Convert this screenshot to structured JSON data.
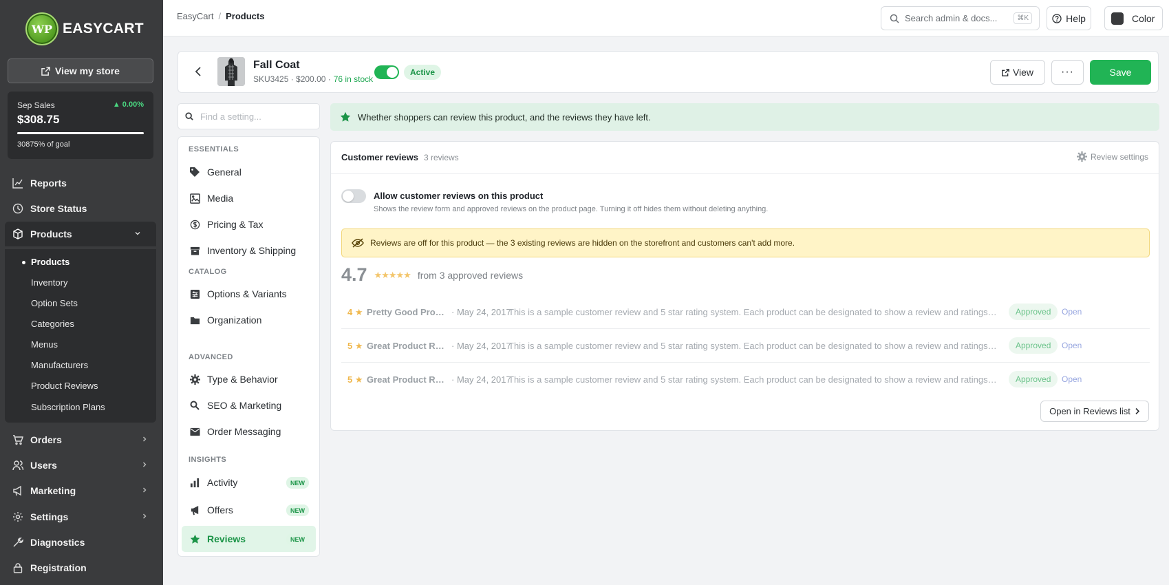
{
  "app": {
    "logo_text": "EASYCART",
    "logo_initials": "WP"
  },
  "sidebar": {
    "view_store_label": "View my store",
    "sales": {
      "label": "Sep Sales",
      "change": "▲ 0.00%",
      "amount": "$308.75",
      "goal_text": "30875% of goal",
      "progress": 1.0
    },
    "nav": [
      {
        "label": "Reports",
        "icon": "chart-line-icon"
      },
      {
        "label": "Store Status",
        "icon": "clock-icon"
      },
      {
        "label": "Products",
        "icon": "box-icon",
        "expanded": true
      },
      {
        "label": "Orders",
        "icon": "cart-icon"
      },
      {
        "label": "Users",
        "icon": "users-icon"
      },
      {
        "label": "Marketing",
        "icon": "megaphone-icon"
      },
      {
        "label": "Settings",
        "icon": "gear-icon"
      },
      {
        "label": "Diagnostics",
        "icon": "wrench-icon"
      },
      {
        "label": "Registration",
        "icon": "lock-icon"
      }
    ],
    "products_sub": [
      {
        "label": "Products",
        "current": true
      },
      {
        "label": "Inventory"
      },
      {
        "label": "Option Sets"
      },
      {
        "label": "Categories"
      },
      {
        "label": "Menus"
      },
      {
        "label": "Manufacturers"
      },
      {
        "label": "Product Reviews"
      },
      {
        "label": "Subscription Plans"
      }
    ]
  },
  "topbar": {
    "breadcrumb": [
      "EasyCart",
      "Products"
    ],
    "search_placeholder": "Search admin & docs...",
    "search_shortcut": "⌘K",
    "help_label": "Help",
    "color_label": "Color"
  },
  "product": {
    "name": "Fall Coat",
    "meta": "SKU3425 · $200.00 ·",
    "stock": "76 in stock",
    "active": true,
    "status_label": "Active",
    "view_label": "View",
    "more_label": "···",
    "save_label": "Save"
  },
  "settings_nav": {
    "search_placeholder": "Find a setting...",
    "groups": [
      {
        "title": "ESSENTIALS",
        "items": [
          {
            "label": "General",
            "icon": "tag-icon"
          },
          {
            "label": "Media",
            "icon": "image-icon"
          },
          {
            "label": "Pricing & Tax",
            "icon": "dollar-icon"
          },
          {
            "label": "Inventory & Shipping",
            "icon": "archive-icon"
          }
        ]
      },
      {
        "title": "CATALOG",
        "items": [
          {
            "label": "Options & Variants",
            "icon": "options-icon"
          },
          {
            "label": "Organization",
            "icon": "folder-icon"
          }
        ]
      },
      {
        "title": "ADVANCED",
        "items": [
          {
            "label": "Type & Behavior",
            "icon": "gear-icon"
          },
          {
            "label": "SEO & Marketing",
            "icon": "search-icon"
          },
          {
            "label": "Order Messaging",
            "icon": "envelope-icon"
          }
        ]
      },
      {
        "title": "INSIGHTS",
        "items": [
          {
            "label": "Activity",
            "icon": "bar-chart-icon",
            "badge": "NEW"
          },
          {
            "label": "Offers",
            "icon": "megaphone-icon",
            "badge": "NEW"
          },
          {
            "label": "Reviews",
            "icon": "star-icon",
            "badge": "NEW",
            "selected": true
          }
        ]
      }
    ]
  },
  "reviews": {
    "info_banner": "Whether shoppers can review this product, and the reviews they have left.",
    "card_title": "Customer reviews",
    "card_count": "3 reviews",
    "settings_label": "Review settings",
    "allow_enabled": false,
    "allow_title": "Allow customer reviews on this product",
    "allow_desc": "Shows the review form and approved reviews on the product page. Turning it off hides them without deleting anything.",
    "warning": "Reviews are off for this product — the 3 existing reviews are hidden on the storefront and customers can't add more.",
    "average": "4.7",
    "stars": "★★★★★",
    "from_text": "from 3 approved reviews",
    "items": [
      {
        "rating": "4 ★",
        "title": "Pretty Good Produ...",
        "date": "· May 24, 2017",
        "text": "This is a sample customer review and 5 star rating system. Each product can be designated to show a review and ratings are automatically...",
        "status": "Approved",
        "action": "Open"
      },
      {
        "rating": "5 ★",
        "title": "Great Product Revi...",
        "date": "· May 24, 2017",
        "text": "This is a sample customer review and 5 star rating system. Each product can be designated to show a review and ratings are automatically...",
        "status": "Approved",
        "action": "Open"
      },
      {
        "rating": "5 ★",
        "title": "Great Product Revi...",
        "date": "· May 24, 2017",
        "text": "This is a sample customer review and 5 star rating system. Each product can be designated to show a review and ratings are automatically...",
        "status": "Approved",
        "action": "Open"
      }
    ],
    "open_list_label": "Open in Reviews list"
  },
  "colors": {
    "accent": "#21b455",
    "sidebar_bg": "#3a3b3d",
    "warning_bg": "#fff4c7",
    "info_bg": "#dff1e6"
  }
}
